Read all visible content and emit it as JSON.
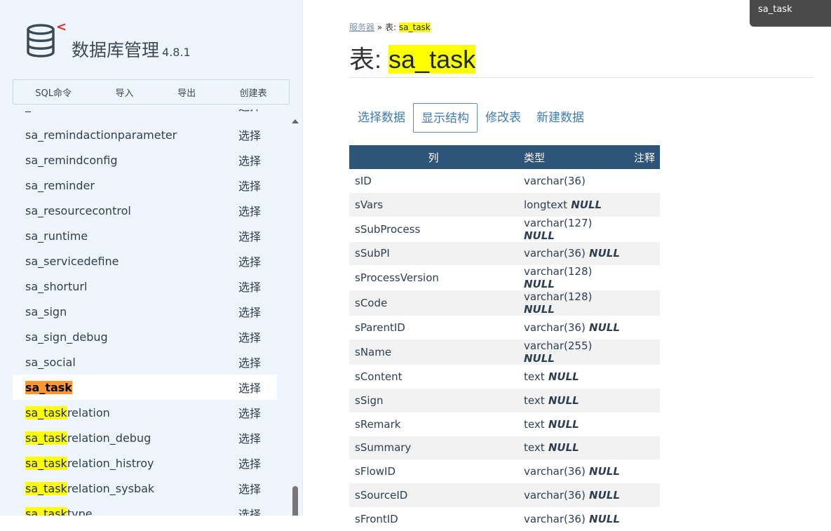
{
  "app": {
    "title": "数据库管理",
    "version": "4.8.1"
  },
  "commands": [
    "SQL命令",
    "导入",
    "导出",
    "创建表"
  ],
  "select_label": "选择",
  "tables_before": [
    "sa_remindactionparameter",
    "sa_remindconfig",
    "sa_reminder",
    "sa_resourcecontrol",
    "sa_runtime",
    "sa_servicedefine",
    "sa_shorturl",
    "sa_sign",
    "sa_sign_debug",
    "sa_social"
  ],
  "partial_top_row": {
    "name": "_",
    "select": "选择"
  },
  "active_table": "sa_task",
  "related_tables": [
    {
      "prefix": "sa_task",
      "suffix": "relation"
    },
    {
      "prefix": "sa_task",
      "suffix": "relation_debug"
    },
    {
      "prefix": "sa_task",
      "suffix": "relation_histroy"
    },
    {
      "prefix": "sa_task",
      "suffix": "relation_sysbak"
    },
    {
      "prefix": "sa_task",
      "suffix": "type"
    }
  ],
  "breadcrumb": {
    "server": "服务器",
    "sep": "»",
    "label": "表:",
    "table": "sa_task"
  },
  "page_title": {
    "label": "表:",
    "table": "sa_task"
  },
  "tabs": [
    "选择数据",
    "显示结构",
    "修改表",
    "新建数据"
  ],
  "active_tab": 1,
  "columns_header": [
    "列",
    "类型",
    "注释"
  ],
  "columns": [
    {
      "name": "sID",
      "type": "varchar(36)",
      "null": ""
    },
    {
      "name": "sVars",
      "type": "longtext",
      "null": "NULL"
    },
    {
      "name": "sSubProcess",
      "type": "varchar(127)",
      "null": "NULL"
    },
    {
      "name": "sSubPI",
      "type": "varchar(36)",
      "null": "NULL"
    },
    {
      "name": "sProcessVersion",
      "type": "varchar(128)",
      "null": "NULL"
    },
    {
      "name": "sCode",
      "type": "varchar(128)",
      "null": "NULL"
    },
    {
      "name": "sParentID",
      "type": "varchar(36)",
      "null": "NULL"
    },
    {
      "name": "sName",
      "type": "varchar(255)",
      "null": "NULL"
    },
    {
      "name": "sContent",
      "type": "text",
      "null": "NULL"
    },
    {
      "name": "sSign",
      "type": "text",
      "null": "NULL"
    },
    {
      "name": "sRemark",
      "type": "text",
      "null": "NULL"
    },
    {
      "name": "sSummary",
      "type": "text",
      "null": "NULL"
    },
    {
      "name": "sFlowID",
      "type": "varchar(36)",
      "null": "NULL"
    },
    {
      "name": "sSourceID",
      "type": "varchar(36)",
      "null": "NULL"
    },
    {
      "name": "sFrontID",
      "type": "varchar(36)",
      "null": "NULL"
    }
  ],
  "tooltip": "sa_task",
  "colors": {
    "header_bg": "#2f547a",
    "highlight": "#ffff00",
    "active_highlight": "#ff9632",
    "link": "#3f7bb3"
  }
}
